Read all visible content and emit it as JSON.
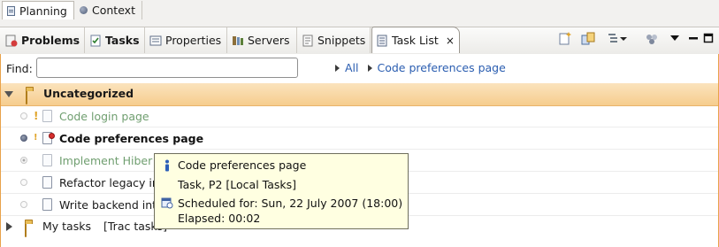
{
  "perspectives": {
    "items": [
      {
        "label": "Planning",
        "icon": "planning-doc-icon",
        "active": true
      },
      {
        "label": "Context",
        "icon": "context-dot-icon",
        "active": false
      }
    ]
  },
  "views": {
    "tabs": [
      {
        "label": "Problems",
        "icon": "problems-icon",
        "bold": true
      },
      {
        "label": "Tasks",
        "icon": "tasks-icon",
        "bold": true
      },
      {
        "label": "Properties",
        "icon": "properties-icon",
        "bold": false
      },
      {
        "label": "Servers",
        "icon": "servers-icon",
        "bold": false
      },
      {
        "label": "Snippets",
        "icon": "snippets-icon",
        "bold": false
      },
      {
        "label": "Task List",
        "icon": "task-list-icon",
        "bold": false,
        "active": true,
        "close": "×"
      }
    ]
  },
  "find": {
    "label": "Find:",
    "value": "",
    "placeholder": ""
  },
  "breadcrumb": {
    "items": [
      "All",
      "Code preferences page"
    ]
  },
  "categories": [
    {
      "name": "Uncategorized",
      "expanded": true,
      "tasks": [
        {
          "label": "Code login page",
          "state": "completed",
          "priority": "!"
        },
        {
          "label": "Code preferences page",
          "state": "active",
          "priority": "!",
          "scheduled": true
        },
        {
          "label": "Implement Hiber",
          "state": "completed",
          "priority": ""
        },
        {
          "label": "Refactor legacy in",
          "state": "open",
          "priority": ""
        },
        {
          "label": "Write backend int",
          "state": "open",
          "priority": ""
        }
      ]
    },
    {
      "name": "My tasks",
      "repository": "[Trac tasks]",
      "expanded": false
    }
  ],
  "tooltip": {
    "title": "Code preferences page",
    "kind": "Task, P2  [Local Tasks]",
    "scheduled": "Scheduled for: Sun, 22 July 2007 (18:00)",
    "elapsed": "Elapsed: 00:02"
  },
  "colors": {
    "accent_orange": "#e8a24a",
    "category_header": "#f6cd8e",
    "link": "#2a5db0",
    "completed_task": "#6f9e6f",
    "tooltip_bg": "#ffffe1",
    "alarm_red": "#d62d2d"
  }
}
